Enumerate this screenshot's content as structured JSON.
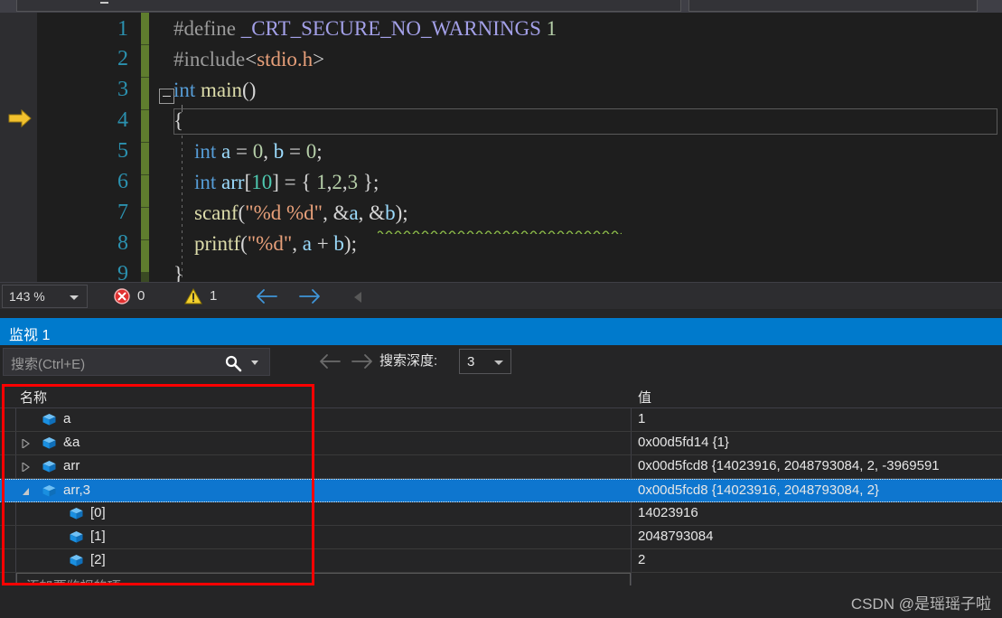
{
  "app": {
    "theme_accent": "#007acc",
    "background": "#1e1e1e"
  },
  "editor": {
    "zoom_level": "143 %",
    "error_count": "0",
    "warning_count": "1",
    "line_numbers": [
      "1",
      "2",
      "3",
      "4",
      "5",
      "6",
      "7",
      "8",
      "9"
    ],
    "execution_pointer_line": 4,
    "code_lines": [
      {
        "n": 1,
        "tokens": [
          {
            "t": "#define ",
            "c": "k-pre"
          },
          {
            "t": "_CRT_SECURE_NO_WARNINGS",
            "c": "k-macro"
          },
          {
            "t": " ",
            "c": "k-plain"
          },
          {
            "t": "1",
            "c": "k-num"
          }
        ]
      },
      {
        "n": 2,
        "tokens": [
          {
            "t": "#include",
            "c": "k-pre"
          },
          {
            "t": "<",
            "c": "k-plain"
          },
          {
            "t": "stdio.h",
            "c": "k-str"
          },
          {
            "t": ">",
            "c": "k-plain"
          }
        ]
      },
      {
        "n": 3,
        "tokens": [
          {
            "t": "int",
            "c": "k-kw"
          },
          {
            "t": " ",
            "c": "k-plain"
          },
          {
            "t": "main",
            "c": "k-fn"
          },
          {
            "t": "()",
            "c": "k-plain"
          }
        ]
      },
      {
        "n": 4,
        "tokens": [
          {
            "t": "{",
            "c": "k-plain"
          }
        ]
      },
      {
        "n": 5,
        "tokens": [
          {
            "t": "    ",
            "c": "k-plain"
          },
          {
            "t": "int",
            "c": "k-kw"
          },
          {
            "t": " ",
            "c": "k-plain"
          },
          {
            "t": "a",
            "c": "k-var"
          },
          {
            "t": " = ",
            "c": "k-plain"
          },
          {
            "t": "0",
            "c": "k-num"
          },
          {
            "t": ", ",
            "c": "k-plain"
          },
          {
            "t": "b",
            "c": "k-var"
          },
          {
            "t": " = ",
            "c": "k-plain"
          },
          {
            "t": "0",
            "c": "k-num"
          },
          {
            "t": ";",
            "c": "k-plain"
          }
        ]
      },
      {
        "n": 6,
        "tokens": [
          {
            "t": "    ",
            "c": "k-plain"
          },
          {
            "t": "int",
            "c": "k-kw"
          },
          {
            "t": " ",
            "c": "k-plain"
          },
          {
            "t": "arr",
            "c": "k-var"
          },
          {
            "t": "[",
            "c": "k-plain"
          },
          {
            "t": "10",
            "c": "k-type"
          },
          {
            "t": "] = { ",
            "c": "k-plain"
          },
          {
            "t": "1",
            "c": "k-num"
          },
          {
            "t": ",",
            "c": "k-plain"
          },
          {
            "t": "2",
            "c": "k-num"
          },
          {
            "t": ",",
            "c": "k-plain"
          },
          {
            "t": "3",
            "c": "k-num"
          },
          {
            "t": " };",
            "c": "k-plain"
          }
        ]
      },
      {
        "n": 7,
        "tokens": [
          {
            "t": "    ",
            "c": "k-plain"
          },
          {
            "t": "scanf",
            "c": "k-fn"
          },
          {
            "t": "(",
            "c": "k-plain"
          },
          {
            "t": "\"%d %d\"",
            "c": "k-str"
          },
          {
            "t": ", &",
            "c": "k-plain"
          },
          {
            "t": "a",
            "c": "k-var"
          },
          {
            "t": ", &",
            "c": "k-plain"
          },
          {
            "t": "b",
            "c": "k-var"
          },
          {
            "t": ");",
            "c": "k-plain"
          }
        ]
      },
      {
        "n": 8,
        "tokens": [
          {
            "t": "    ",
            "c": "k-plain"
          },
          {
            "t": "printf",
            "c": "k-fn"
          },
          {
            "t": "(",
            "c": "k-plain"
          },
          {
            "t": "\"%d\"",
            "c": "k-str"
          },
          {
            "t": ", ",
            "c": "k-plain"
          },
          {
            "t": "a",
            "c": "k-var"
          },
          {
            "t": " + ",
            "c": "k-plain"
          },
          {
            "t": "b",
            "c": "k-var"
          },
          {
            "t": ");",
            "c": "k-plain"
          }
        ]
      },
      {
        "n": 9,
        "tokens": [
          {
            "t": "}",
            "c": "k-plain"
          }
        ]
      }
    ]
  },
  "watch": {
    "tab_label": "监视 1",
    "search_placeholder": "搜索(Ctrl+E)",
    "search_value": "",
    "depth_label": "搜索深度:",
    "depth_value": "3",
    "columns": {
      "name": "名称",
      "value": "值"
    },
    "rows": [
      {
        "name": "a",
        "value": "1",
        "indent": 0,
        "expander": "none",
        "selected": false
      },
      {
        "name": "&a",
        "value": "0x00d5fd14 {1}",
        "indent": 0,
        "expander": "collapsed",
        "selected": false
      },
      {
        "name": "arr",
        "value": "0x00d5fcd8 {14023916, 2048793084, 2, -3969591",
        "indent": 0,
        "expander": "collapsed",
        "selected": false
      },
      {
        "name": "arr,3",
        "value": "0x00d5fcd8 {14023916, 2048793084, 2}",
        "indent": 0,
        "expander": "expanded",
        "selected": true
      },
      {
        "name": "[0]",
        "value": "14023916",
        "indent": 1,
        "expander": "none",
        "selected": false
      },
      {
        "name": "[1]",
        "value": "2048793084",
        "indent": 1,
        "expander": "none",
        "selected": false
      },
      {
        "name": "[2]",
        "value": "2",
        "indent": 1,
        "expander": "none",
        "selected": false
      }
    ],
    "add_item_placeholder": "添加要监视的项"
  },
  "watermark": {
    "text": "CSDN @是瑶瑶子啦"
  },
  "annotation": {
    "color": "#ff0000"
  }
}
